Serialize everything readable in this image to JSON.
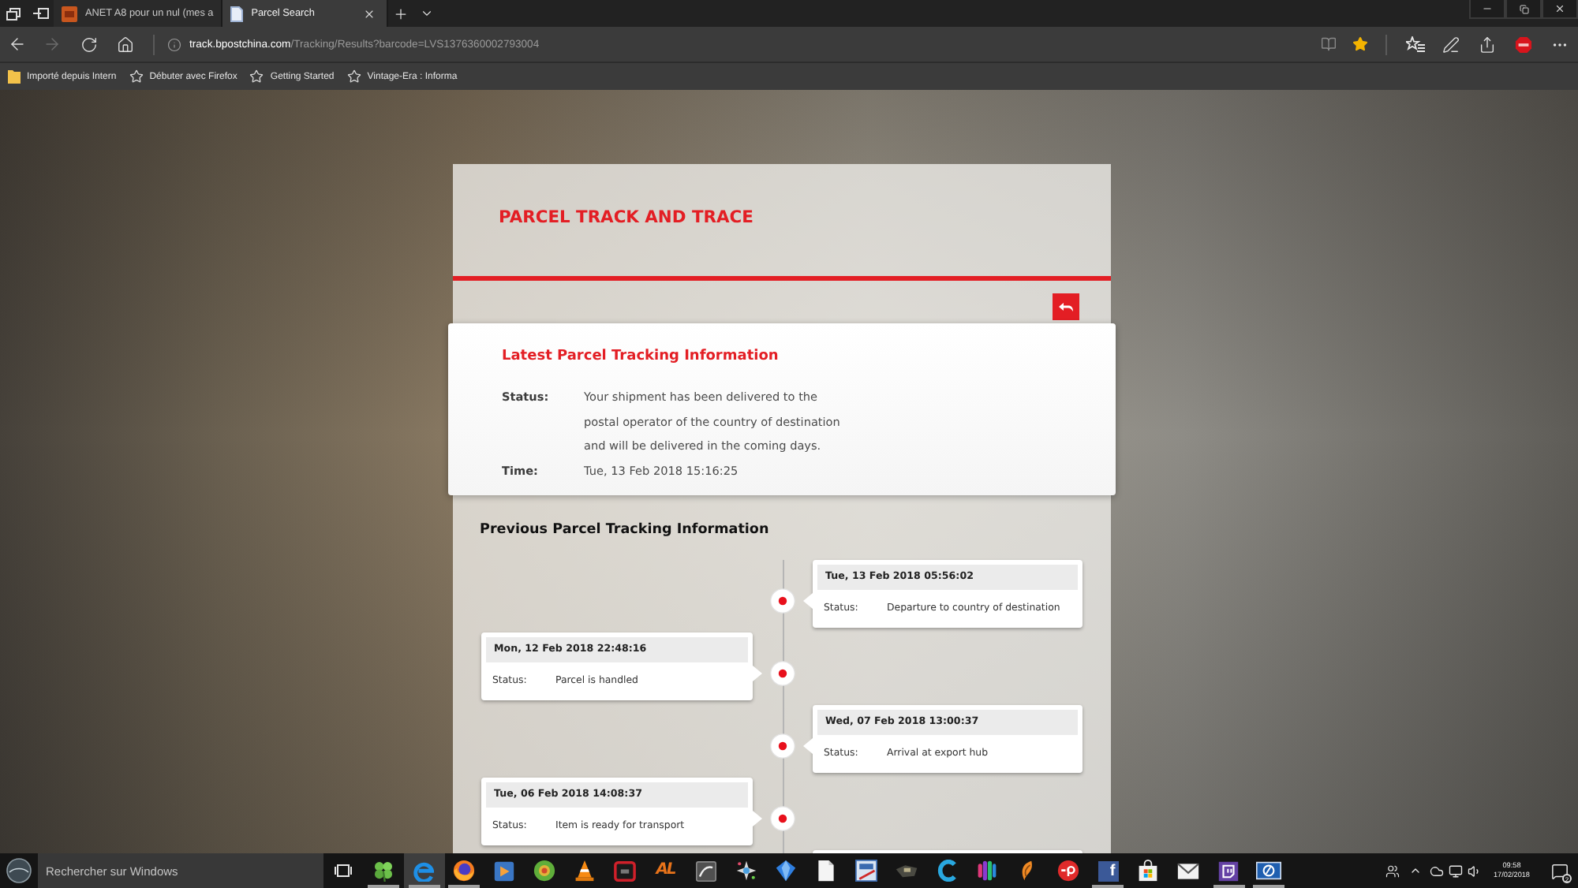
{
  "browser": {
    "tabs": [
      {
        "title": "ANET A8 pour un nul (mes a",
        "selected": false
      },
      {
        "title": "Parcel Search",
        "selected": true
      }
    ],
    "forward_disabled": true,
    "address": {
      "domain": "track.bpostchina.com",
      "path": "/Tracking/Results?barcode=LVS1376360002793004"
    },
    "favorite": true,
    "favorites_bar": [
      {
        "kind": "folder",
        "label": "Importé depuis Intern"
      },
      {
        "kind": "star",
        "label": "Débuter avec Firefox"
      },
      {
        "kind": "star",
        "label": "Getting Started"
      },
      {
        "kind": "star",
        "label": "Vintage-Era : Informa"
      }
    ]
  },
  "page": {
    "title": "PARCEL TRACK AND TRACE",
    "latest": {
      "heading": "Latest Parcel Tracking Information",
      "fields": [
        {
          "label": "Status:",
          "lines": [
            "Your shipment has been delivered to the",
            "postal operator of the country of destination",
            "and will be delivered in the coming days."
          ]
        },
        {
          "label": "Time:",
          "lines": [
            "Tue, 13 Feb 2018 15:16:25"
          ]
        }
      ]
    },
    "previous": {
      "heading": "Previous Parcel Tracking Information",
      "events": [
        {
          "time": "Tue, 13 Feb 2018 05:56:02",
          "status_label": "Status:",
          "status": "Departure to country of destination"
        },
        {
          "time": "Mon, 12 Feb 2018 22:48:16",
          "status_label": "Status:",
          "status": "Parcel is handled"
        },
        {
          "time": "Wed, 07 Feb 2018 13:00:37",
          "status_label": "Status:",
          "status": "Arrival at export hub"
        },
        {
          "time": "Tue, 06 Feb 2018 14:08:37",
          "status_label": "Status:",
          "status": "Item is ready for transport"
        }
      ]
    }
  },
  "taskbar": {
    "search": {
      "placeholder": "Rechercher sur Windows"
    },
    "apps": [
      {
        "kind": "clover",
        "running": true,
        "selected": false
      },
      {
        "kind": "e-arc",
        "running": true,
        "selected": true
      },
      {
        "kind": "globe",
        "running": true,
        "selected": false
      },
      {
        "kind": "play-tile",
        "running": false,
        "selected": false
      },
      {
        "kind": "target",
        "running": false,
        "selected": false
      },
      {
        "kind": "cone",
        "running": false,
        "selected": false
      },
      {
        "kind": "framed-screen",
        "running": false,
        "selected": false
      },
      {
        "kind": "text-logo",
        "label": "AL",
        "running": false,
        "selected": false
      },
      {
        "kind": "swoosh-tile",
        "running": false,
        "selected": false
      },
      {
        "kind": "splash",
        "running": false,
        "selected": false
      },
      {
        "kind": "gem",
        "running": false,
        "selected": false
      },
      {
        "kind": "document",
        "running": false,
        "selected": false
      },
      {
        "kind": "picture",
        "running": false,
        "selected": false
      },
      {
        "kind": "gadget",
        "running": false,
        "selected": false
      },
      {
        "kind": "c-arc",
        "running": false,
        "selected": false
      },
      {
        "kind": "color-bars",
        "running": false,
        "selected": false
      },
      {
        "kind": "leaf",
        "running": false,
        "selected": false
      },
      {
        "kind": "round-badge",
        "running": false,
        "selected": false
      },
      {
        "kind": "letter-tile",
        "label": "f",
        "running": true,
        "selected": false
      },
      {
        "kind": "bag",
        "running": false,
        "selected": false
      },
      {
        "kind": "mail",
        "running": false,
        "selected": false
      },
      {
        "kind": "chat-tile",
        "running": true,
        "selected": false
      },
      {
        "kind": "ring-tile",
        "running": true,
        "selected": false
      }
    ],
    "clock": {
      "time": "09:58",
      "date": "17/02/2018"
    },
    "notification_count": "2"
  }
}
